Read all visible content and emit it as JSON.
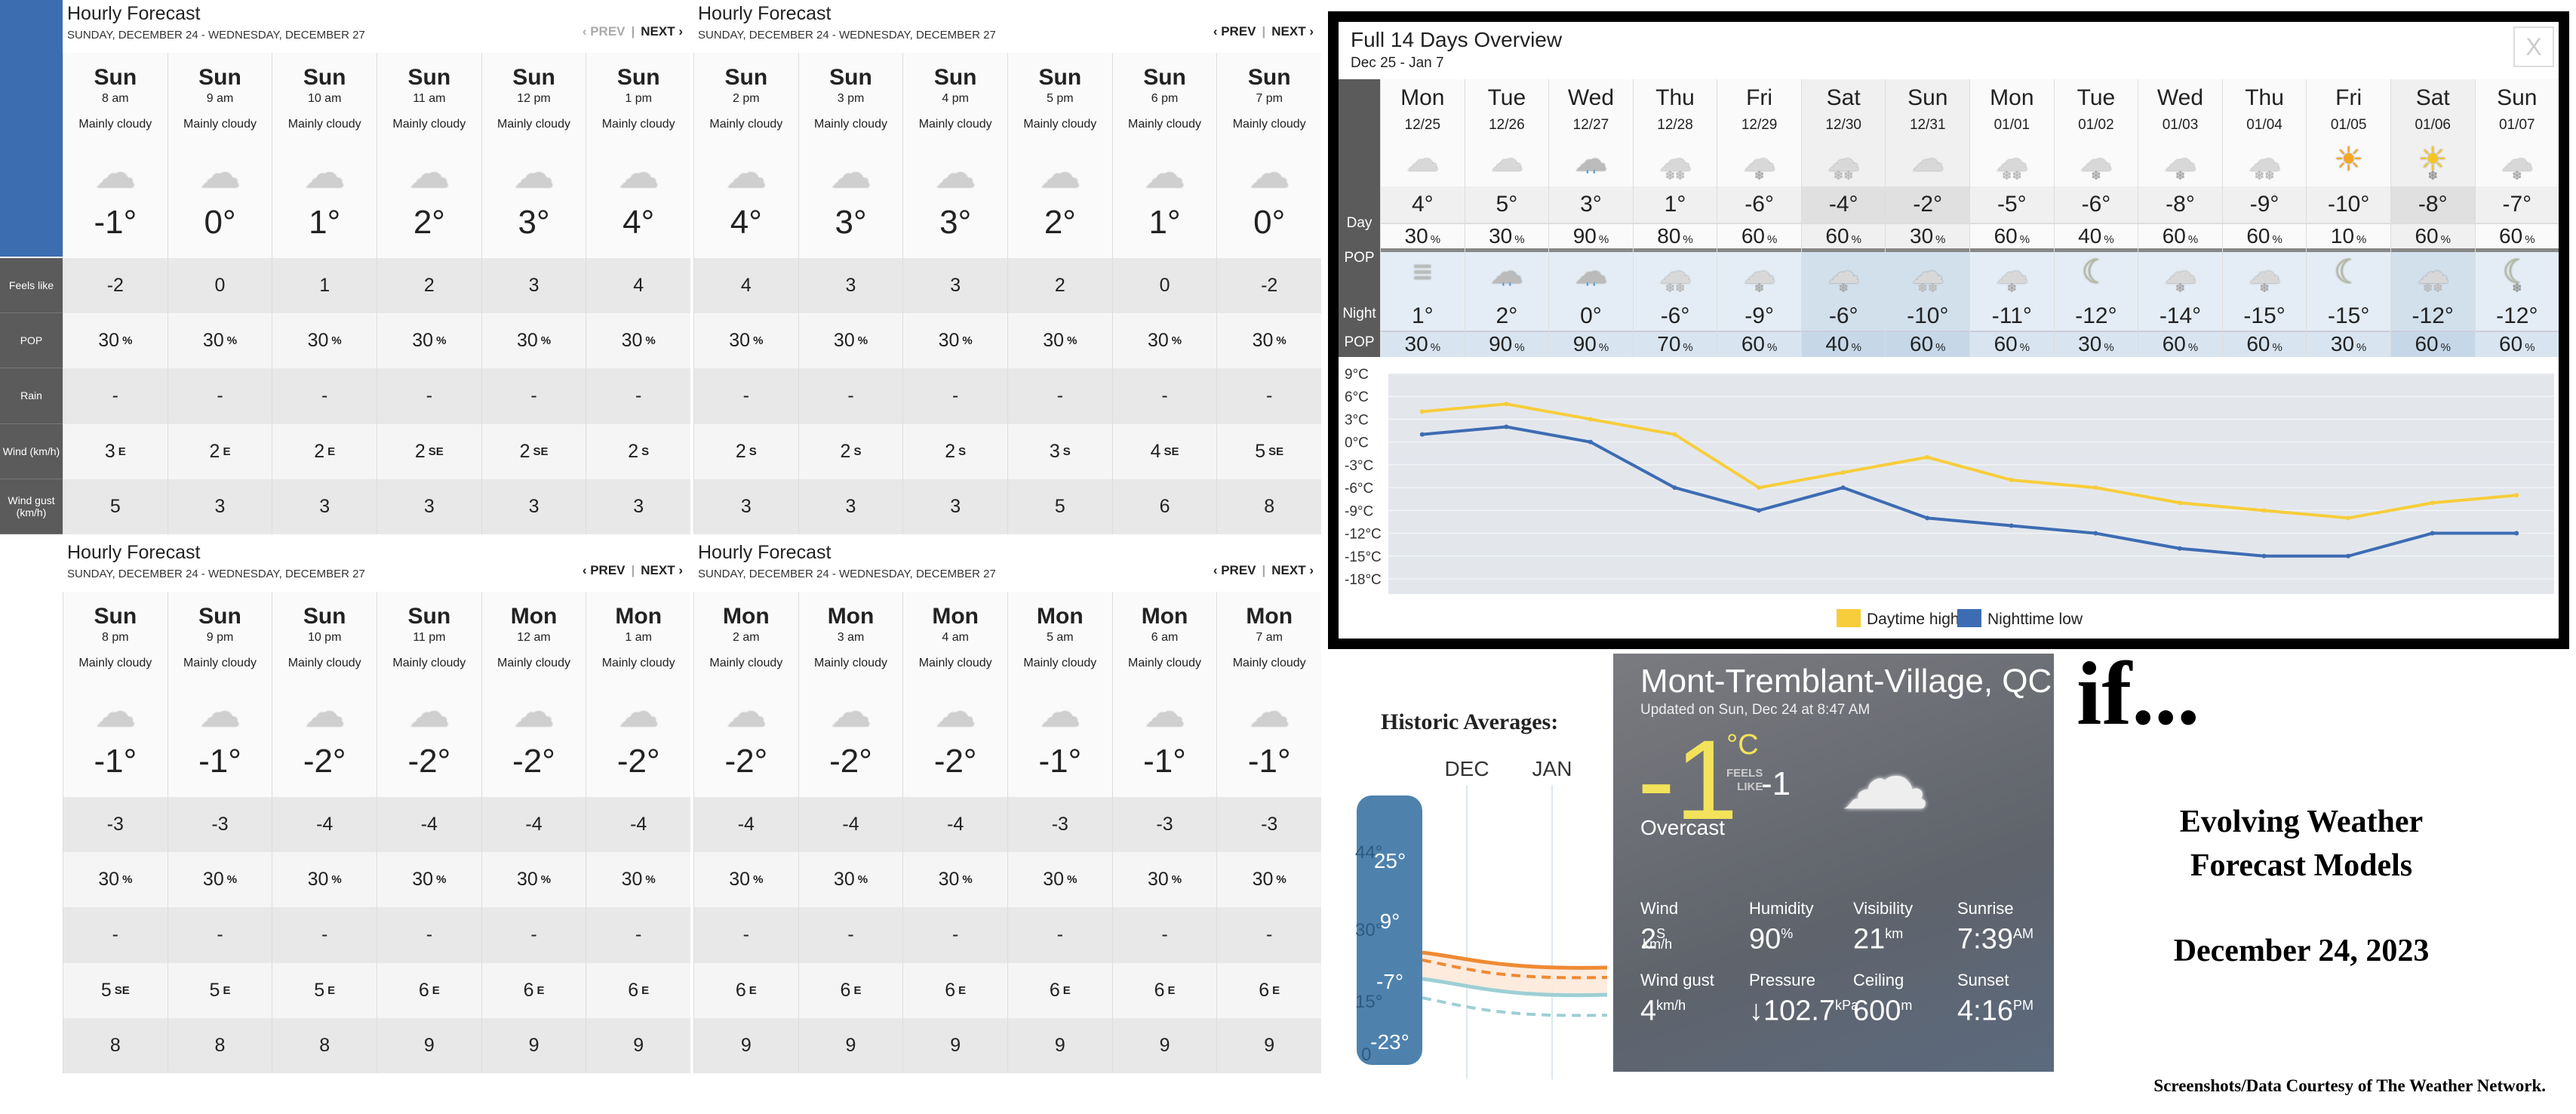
{
  "hourly_labels": [
    "Feels like",
    "POP",
    "Rain",
    "Wind (km/h)",
    "Wind gust (km/h)"
  ],
  "hourly_panels": [
    {
      "title": "Hourly Forecast",
      "subtitle": "Sunday, December 24 - Wednesday, December 27",
      "prev": "‹ PREV",
      "next": "NEXT ›",
      "prev_disabled": true,
      "hours": [
        {
          "day": "Sun",
          "time": "8 am",
          "cond": "Mainly cloudy",
          "icon": "cloud-icon",
          "temp": "-1°",
          "feels": "-2",
          "pop": "30",
          "rain": "-",
          "wind": "3",
          "dir": "E",
          "gust": "5"
        },
        {
          "day": "Sun",
          "time": "9 am",
          "cond": "Mainly cloudy",
          "icon": "cloud-icon",
          "temp": "0°",
          "feels": "0",
          "pop": "30",
          "rain": "-",
          "wind": "2",
          "dir": "E",
          "gust": "3"
        },
        {
          "day": "Sun",
          "time": "10 am",
          "cond": "Mainly cloudy",
          "icon": "cloud-icon",
          "temp": "1°",
          "feels": "1",
          "pop": "30",
          "rain": "-",
          "wind": "2",
          "dir": "E",
          "gust": "3"
        },
        {
          "day": "Sun",
          "time": "11 am",
          "cond": "Mainly cloudy",
          "icon": "cloud-icon",
          "temp": "2°",
          "feels": "2",
          "pop": "30",
          "rain": "-",
          "wind": "2",
          "dir": "SE",
          "gust": "3"
        },
        {
          "day": "Sun",
          "time": "12 pm",
          "cond": "Mainly cloudy",
          "icon": "cloud-icon",
          "temp": "3°",
          "feels": "3",
          "pop": "30",
          "rain": "-",
          "wind": "2",
          "dir": "SE",
          "gust": "3"
        },
        {
          "day": "Sun",
          "time": "1 pm",
          "cond": "Mainly cloudy",
          "icon": "cloud-icon",
          "temp": "4°",
          "feels": "4",
          "pop": "30",
          "rain": "-",
          "wind": "2",
          "dir": "S",
          "gust": "3"
        }
      ]
    },
    {
      "title": "Hourly Forecast",
      "subtitle": "Sunday, December 24 - Wednesday, December 27",
      "prev": "‹ PREV",
      "next": "NEXT ›",
      "prev_disabled": false,
      "hours": [
        {
          "day": "Sun",
          "time": "2 pm",
          "cond": "Mainly cloudy",
          "icon": "cloud-icon",
          "temp": "4°",
          "feels": "4",
          "pop": "30",
          "rain": "-",
          "wind": "2",
          "dir": "S",
          "gust": "3"
        },
        {
          "day": "Sun",
          "time": "3 pm",
          "cond": "Mainly cloudy",
          "icon": "cloud-icon",
          "temp": "3°",
          "feels": "3",
          "pop": "30",
          "rain": "-",
          "wind": "2",
          "dir": "S",
          "gust": "3"
        },
        {
          "day": "Sun",
          "time": "4 pm",
          "cond": "Mainly cloudy",
          "icon": "cloud-icon",
          "temp": "3°",
          "feels": "3",
          "pop": "30",
          "rain": "-",
          "wind": "2",
          "dir": "S",
          "gust": "3"
        },
        {
          "day": "Sun",
          "time": "5 pm",
          "cond": "Mainly cloudy",
          "icon": "cloud-icon",
          "temp": "2°",
          "feels": "2",
          "pop": "30",
          "rain": "-",
          "wind": "3",
          "dir": "S",
          "gust": "5"
        },
        {
          "day": "Sun",
          "time": "6 pm",
          "cond": "Mainly cloudy",
          "icon": "cloud-icon",
          "temp": "1°",
          "feels": "0",
          "pop": "30",
          "rain": "-",
          "wind": "4",
          "dir": "SE",
          "gust": "6"
        },
        {
          "day": "Sun",
          "time": "7 pm",
          "cond": "Mainly cloudy",
          "icon": "cloud-icon",
          "temp": "0°",
          "feels": "-2",
          "pop": "30",
          "rain": "-",
          "wind": "5",
          "dir": "SE",
          "gust": "8"
        }
      ]
    },
    {
      "title": "Hourly Forecast",
      "subtitle": "Sunday, December 24 - Wednesday, December 27",
      "prev": "‹ PREV",
      "next": "NEXT ›",
      "prev_disabled": false,
      "hours": [
        {
          "day": "Sun",
          "time": "8 pm",
          "cond": "Mainly cloudy",
          "icon": "cloud-icon",
          "temp": "-1°",
          "feels": "-3",
          "pop": "30",
          "rain": "-",
          "wind": "5",
          "dir": "SE",
          "gust": "8"
        },
        {
          "day": "Sun",
          "time": "9 pm",
          "cond": "Mainly cloudy",
          "icon": "cloud-icon",
          "temp": "-1°",
          "feels": "-3",
          "pop": "30",
          "rain": "-",
          "wind": "5",
          "dir": "E",
          "gust": "8"
        },
        {
          "day": "Sun",
          "time": "10 pm",
          "cond": "Mainly cloudy",
          "icon": "cloud-icon",
          "temp": "-2°",
          "feels": "-4",
          "pop": "30",
          "rain": "-",
          "wind": "5",
          "dir": "E",
          "gust": "8"
        },
        {
          "day": "Sun",
          "time": "11 pm",
          "cond": "Mainly cloudy",
          "icon": "cloud-icon",
          "temp": "-2°",
          "feels": "-4",
          "pop": "30",
          "rain": "-",
          "wind": "6",
          "dir": "E",
          "gust": "9"
        },
        {
          "day": "Mon",
          "time": "12 am",
          "cond": "Mainly cloudy",
          "icon": "cloud-icon",
          "temp": "-2°",
          "feels": "-4",
          "pop": "30",
          "rain": "-",
          "wind": "6",
          "dir": "E",
          "gust": "9"
        },
        {
          "day": "Mon",
          "time": "1 am",
          "cond": "Mainly cloudy",
          "icon": "cloud-icon",
          "temp": "-2°",
          "feels": "-4",
          "pop": "30",
          "rain": "-",
          "wind": "6",
          "dir": "E",
          "gust": "9"
        }
      ]
    },
    {
      "title": "Hourly Forecast",
      "subtitle": "Sunday, December 24 - Wednesday, December 27",
      "prev": "‹ PREV",
      "next": "NEXT ›",
      "prev_disabled": false,
      "hours": [
        {
          "day": "Mon",
          "time": "2 am",
          "cond": "Mainly cloudy",
          "icon": "cloud-icon",
          "temp": "-2°",
          "feels": "-4",
          "pop": "30",
          "rain": "-",
          "wind": "6",
          "dir": "E",
          "gust": "9"
        },
        {
          "day": "Mon",
          "time": "3 am",
          "cond": "Mainly cloudy",
          "icon": "cloud-icon",
          "temp": "-2°",
          "feels": "-4",
          "pop": "30",
          "rain": "-",
          "wind": "6",
          "dir": "E",
          "gust": "9"
        },
        {
          "day": "Mon",
          "time": "4 am",
          "cond": "Mainly cloudy",
          "icon": "cloud-icon",
          "temp": "-2°",
          "feels": "-4",
          "pop": "30",
          "rain": "-",
          "wind": "6",
          "dir": "E",
          "gust": "9"
        },
        {
          "day": "Mon",
          "time": "5 am",
          "cond": "Mainly cloudy",
          "icon": "cloud-icon",
          "temp": "-1°",
          "feels": "-3",
          "pop": "30",
          "rain": "-",
          "wind": "6",
          "dir": "E",
          "gust": "9"
        },
        {
          "day": "Mon",
          "time": "6 am",
          "cond": "Mainly cloudy",
          "icon": "cloud-icon",
          "temp": "-1°",
          "feels": "-3",
          "pop": "30",
          "rain": "-",
          "wind": "6",
          "dir": "E",
          "gust": "9"
        },
        {
          "day": "Mon",
          "time": "7 am",
          "cond": "Mainly cloudy",
          "icon": "cloud-icon",
          "temp": "-1°",
          "feels": "-3",
          "pop": "30",
          "rain": "-",
          "wind": "6",
          "dir": "E",
          "gust": "9"
        }
      ]
    }
  ],
  "pop_unit": "%",
  "overview": {
    "title": "Full 14 Days Overview",
    "subtitle": "Dec 25 - Jan 7",
    "close": "X",
    "row_labels": {
      "day": "Day",
      "pop": "POP",
      "night": "Night",
      "npop": "POP"
    },
    "days": [
      {
        "name": "Mon",
        "date": "12/25",
        "day_icon": "cloudy",
        "day_temp": "4°",
        "day_pop": "30",
        "night_icon": "fog",
        "night_temp": "1°",
        "night_pop": "30",
        "weekend": false
      },
      {
        "name": "Tue",
        "date": "12/26",
        "day_icon": "cloudy",
        "day_temp": "5°",
        "day_pop": "30",
        "night_icon": "rain",
        "night_temp": "2°",
        "night_pop": "90",
        "weekend": false
      },
      {
        "name": "Wed",
        "date": "12/27",
        "day_icon": "rain",
        "day_temp": "3°",
        "day_pop": "90",
        "night_icon": "rain",
        "night_temp": "0°",
        "night_pop": "90",
        "weekend": false
      },
      {
        "name": "Thu",
        "date": "12/28",
        "day_icon": "snow",
        "day_temp": "1°",
        "day_pop": "80",
        "night_icon": "snow",
        "night_temp": "-6°",
        "night_pop": "70",
        "weekend": false
      },
      {
        "name": "Fri",
        "date": "12/29",
        "day_icon": "flurries",
        "day_temp": "-6°",
        "day_pop": "60",
        "night_icon": "flurries",
        "night_temp": "-9°",
        "night_pop": "60",
        "weekend": false
      },
      {
        "name": "Sat",
        "date": "12/30",
        "day_icon": "snow",
        "day_temp": "-4°",
        "day_pop": "60",
        "night_icon": "flurries",
        "night_temp": "-6°",
        "night_pop": "40",
        "weekend": true
      },
      {
        "name": "Sun",
        "date": "12/31",
        "day_icon": "cloudy",
        "day_temp": "-2°",
        "day_pop": "30",
        "night_icon": "snow",
        "night_temp": "-10°",
        "night_pop": "60",
        "weekend": true
      },
      {
        "name": "Mon",
        "date": "01/01",
        "day_icon": "snow",
        "day_temp": "-5°",
        "day_pop": "60",
        "night_icon": "flurries",
        "night_temp": "-11°",
        "night_pop": "60",
        "weekend": false
      },
      {
        "name": "Tue",
        "date": "01/02",
        "day_icon": "flurries",
        "day_temp": "-6°",
        "day_pop": "40",
        "night_icon": "moon-cloud",
        "night_temp": "-12°",
        "night_pop": "30",
        "weekend": false
      },
      {
        "name": "Wed",
        "date": "01/03",
        "day_icon": "flurries",
        "day_temp": "-8°",
        "day_pop": "60",
        "night_icon": "flurries",
        "night_temp": "-14°",
        "night_pop": "60",
        "weekend": false
      },
      {
        "name": "Thu",
        "date": "01/04",
        "day_icon": "snow",
        "day_temp": "-9°",
        "day_pop": "60",
        "night_icon": "flurries",
        "night_temp": "-15°",
        "night_pop": "60",
        "weekend": false
      },
      {
        "name": "Fri",
        "date": "01/05",
        "day_icon": "sun-cloud",
        "day_temp": "-10°",
        "day_pop": "10",
        "night_icon": "moon-cloud",
        "night_temp": "-15°",
        "night_pop": "30",
        "weekend": false
      },
      {
        "name": "Sat",
        "date": "01/06",
        "day_icon": "sun-snow",
        "day_temp": "-8°",
        "day_pop": "60",
        "night_icon": "snow",
        "night_temp": "-12°",
        "night_pop": "60",
        "weekend": true
      },
      {
        "name": "Sun",
        "date": "01/07",
        "day_icon": "flurries",
        "day_temp": "-7°",
        "day_pop": "60",
        "night_icon": "moon-snow",
        "night_temp": "-12°",
        "night_pop": "60",
        "weekend": false
      }
    ]
  },
  "chart_data": {
    "type": "line",
    "categories": [
      "12/25",
      "12/26",
      "12/27",
      "12/28",
      "12/29",
      "12/30",
      "12/31",
      "01/01",
      "01/02",
      "01/03",
      "01/04",
      "01/05",
      "01/06",
      "01/07"
    ],
    "ylim": [
      -18,
      9
    ],
    "yticks": [
      "9°C",
      "6°C",
      "3°C",
      "0°C",
      "-3°C",
      "-6°C",
      "-9°C",
      "-12°C",
      "-15°C",
      "-18°C"
    ],
    "ytick_values": [
      9,
      6,
      3,
      0,
      -3,
      -6,
      -9,
      -12,
      -15,
      -18
    ],
    "grid": true,
    "legend_position": "bottom",
    "series": [
      {
        "name": "Daytime high",
        "color": "#f7cd3b",
        "values": [
          4,
          5,
          3,
          1,
          -6,
          -4,
          -2,
          -5,
          -6,
          -8,
          -9,
          -10,
          -8,
          -7
        ]
      },
      {
        "name": "Nighttime low",
        "color": "#3d6cb3",
        "values": [
          1,
          2,
          0,
          -6,
          -9,
          -6,
          -10,
          -11,
          -12,
          -14,
          -15,
          -15,
          -12,
          -12
        ]
      }
    ]
  },
  "historic": {
    "title": "Historic Averages:",
    "months": [
      "DEC",
      "JAN"
    ],
    "scale": [
      "25°",
      "9°",
      "-7°",
      "-23°"
    ],
    "ghost_scale": [
      "44°",
      "30°",
      "15°",
      "0"
    ]
  },
  "current": {
    "city": "Mont-Tremblant-Village, QC",
    "updated": "Updated on Sun, Dec 24 at 8:47 AM",
    "temp": "-1",
    "unit": "°C",
    "feels_label_1": "FEELS",
    "feels_label_2": "LIKE",
    "feels": "-1",
    "condition": "Overcast",
    "icon": "cloud-icon",
    "stats": [
      {
        "label": "Wind",
        "value": "2",
        "sup": "S",
        "sub": "km/h"
      },
      {
        "label": "Humidity",
        "value": "90",
        "sup": "%",
        "sub": ""
      },
      {
        "label": "Visibility",
        "value": "21",
        "sup": "km",
        "sub": ""
      },
      {
        "label": "Sunrise",
        "value": "7:39",
        "sup": "AM",
        "sub": ""
      },
      {
        "label": "Wind gust",
        "value": "4",
        "sup": "km/h",
        "sub": ""
      },
      {
        "label": "Pressure",
        "value": "↓102.7",
        "sup": "kPa",
        "sub": ""
      },
      {
        "label": "Ceiling",
        "value": "600",
        "sup": "m",
        "sub": ""
      },
      {
        "label": "Sunset",
        "value": "4:16",
        "sup": "PM",
        "sub": ""
      }
    ]
  },
  "annotation": {
    "if": "if...",
    "headline_1": "Evolving Weather",
    "headline_2": "Forecast Models",
    "date": "December 24, 2023",
    "credit": "Screenshots/Data Courtesy of The Weather Network."
  }
}
